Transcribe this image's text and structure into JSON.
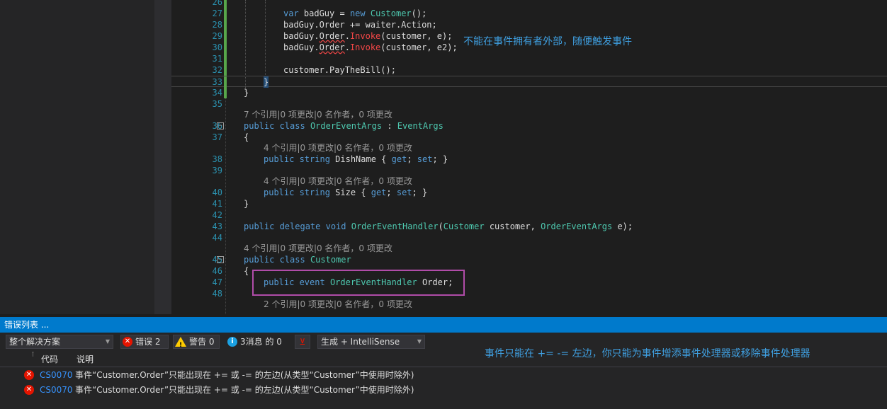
{
  "editor": {
    "lines": [
      {
        "n": "26",
        "code": ""
      },
      {
        "n": "27",
        "code": "var badGuy = new Customer();"
      },
      {
        "n": "28",
        "code": "badGuy.Order += waiter.Action;"
      },
      {
        "n": "29",
        "code": "badGuy.Order.Invoke(customer, e);"
      },
      {
        "n": "30",
        "code": "badGuy.Order.Invoke(customer, e2);"
      },
      {
        "n": "31",
        "code": ""
      },
      {
        "n": "32",
        "code": "customer.PayTheBill();"
      },
      {
        "n": "33",
        "code": "}"
      },
      {
        "n": "34",
        "code": "}"
      },
      {
        "n": "35",
        "code": ""
      },
      {
        "n": "36",
        "code": "public class OrderEventArgs : EventArgs"
      },
      {
        "n": "37",
        "code": "{"
      },
      {
        "n": "38",
        "code": "public string DishName { get; set; }"
      },
      {
        "n": "39",
        "code": ""
      },
      {
        "n": "40",
        "code": "public string Size { get; set; }"
      },
      {
        "n": "41",
        "code": "}"
      },
      {
        "n": "42",
        "code": ""
      },
      {
        "n": "43",
        "code": "public delegate void OrderEventHandler(Customer customer, OrderEventArgs e);"
      },
      {
        "n": "44",
        "code": ""
      },
      {
        "n": "45",
        "code": "public class Customer"
      },
      {
        "n": "46",
        "code": "{"
      },
      {
        "n": "47",
        "code": "public event OrderEventHandler Order;"
      },
      {
        "n": "48",
        "code": ""
      }
    ],
    "codelens": [
      "7 个引用|0 项更改|0 名作者，0 项更改",
      "4 个引用|0 项更改|0 名作者，0 项更改",
      "4 个引用|0 项更改|0 名作者，0 项更改",
      "4 个引用|0 项更改|0 名作者，0 项更改",
      "2 个引用|0 项更改|0 名作者，0 项更改"
    ],
    "annotation_top": "不能在事件拥有者外部，随便触发事件"
  },
  "error_list": {
    "title": "错误列表 ...",
    "scope": "整个解决方案",
    "errors_label": "错误 2",
    "warnings_label": "警告 0",
    "messages_label": "3消息 的 0",
    "build_source": "生成 + IntelliSense",
    "annotation_bottom": "事件只能在 += -= 左边，你只能为事件增添事件处理器或移除事件处理器",
    "col_code": "代码",
    "col_desc": "说明",
    "rows": [
      {
        "code": "CS0070",
        "desc": "事件“Customer.Order”只能出现在 += 或 -= 的左边(从类型“Customer”中使用时除外)"
      },
      {
        "code": "CS0070",
        "desc": "事件“Customer.Order”只能出现在 += 或 -= 的左边(从类型“Customer”中使用时除外)"
      }
    ]
  },
  "colors": {
    "accent": "#007acc",
    "annotation": "#3f9fe0",
    "highlight_box": "#b04ca8",
    "error": "#e51400"
  }
}
